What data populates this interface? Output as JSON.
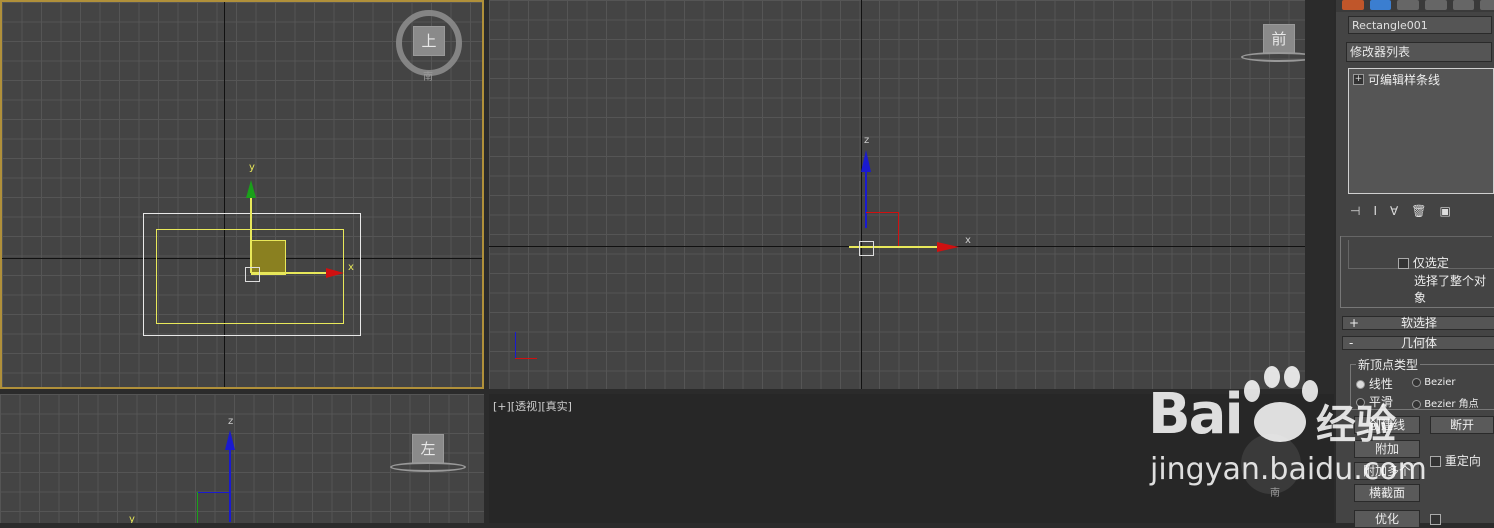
{
  "viewports": {
    "top": {
      "cube_label": "上",
      "south_label": "南",
      "x_axis": "x",
      "y_axis": "y"
    },
    "front": {
      "cube_label": "前",
      "x_axis": "x",
      "z_axis": "z"
    },
    "left": {
      "cube_label": "左",
      "z_axis": "z",
      "y_axis": "y"
    },
    "perspective": {
      "label": "[+][透视][真实]",
      "south_label": "南"
    }
  },
  "panel": {
    "object_name": "Rectangle001",
    "modifier_list": "修改器列表",
    "stack_item": "可编辑样条线",
    "only_selected": "仅选定",
    "selected_whole": "选择了整个对象",
    "soft_selection": "软选择",
    "geometry": "几何体",
    "new_vertex_type": "新顶点类型",
    "linear": "线性",
    "bezier": "Bezier",
    "smooth": "平滑",
    "bezier_corner": "Bezier 角点",
    "create_line": "创建线",
    "break": "断开",
    "attach": "附加",
    "attach_multiple": "附加多个",
    "reorient": "重定向",
    "cross_section": "横截面",
    "optimize": "优化",
    "rollout_minus": "-",
    "rollout_plus": "+"
  },
  "watermark": {
    "brand": "Bai",
    "brand2": "经验",
    "url": "jingyan.baidu.com"
  }
}
